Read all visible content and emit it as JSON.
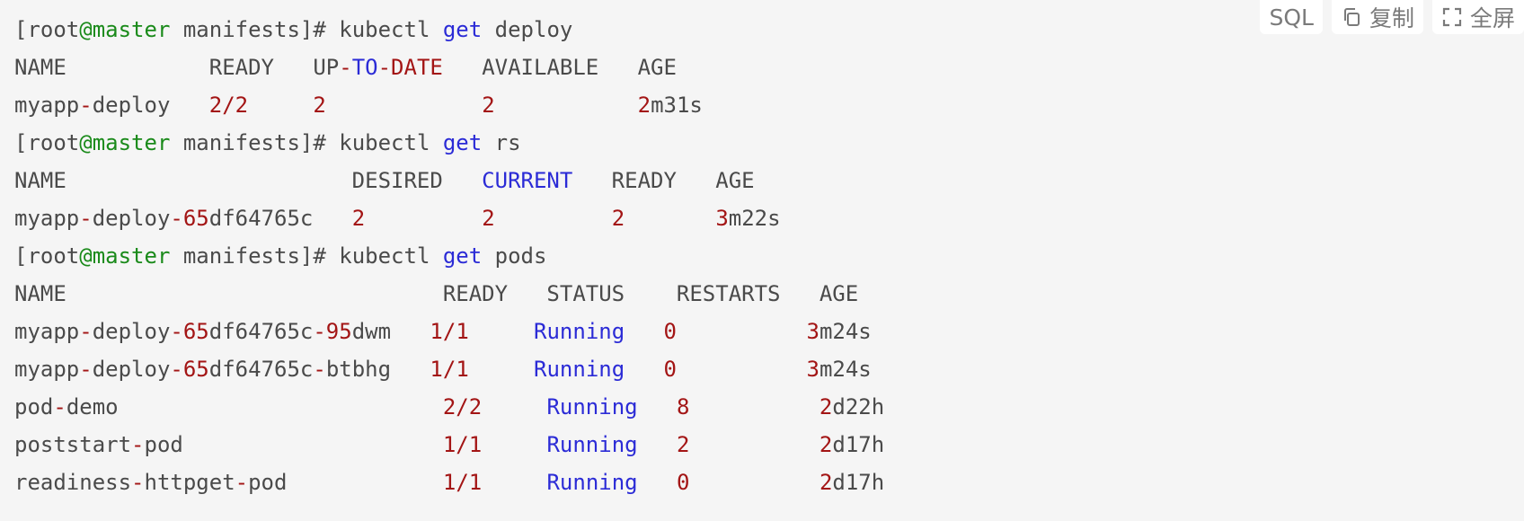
{
  "toolbar": {
    "lang_label": "SQL",
    "copy_label": "复制",
    "fullscreen_label": "全屏",
    "copy_icon": "copy-icon",
    "fullscreen_icon": "fullscreen-icon"
  },
  "colors": {
    "background": "#f5f5f5",
    "text": "#4a4a4a",
    "prompt_host": "#1a8a1a",
    "keyword": "#2b2bd6",
    "number": "#a31515"
  },
  "lines": [
    [
      {
        "t": "[root"
      },
      {
        "t": "@master",
        "c": "green"
      },
      {
        "t": " manifests]# kubectl "
      },
      {
        "t": "get",
        "c": "blue"
      },
      {
        "t": " deploy"
      }
    ],
    [
      {
        "t": "NAME           READY   UP"
      },
      {
        "t": "-",
        "c": "red"
      },
      {
        "t": "TO",
        "c": "blue"
      },
      {
        "t": "-",
        "c": "red"
      },
      {
        "t": "DATE",
        "c": "red"
      },
      {
        "t": "   AVAILABLE   AGE"
      }
    ],
    [
      {
        "t": "myapp"
      },
      {
        "t": "-",
        "c": "red"
      },
      {
        "t": "deploy   "
      },
      {
        "t": "2",
        "c": "red"
      },
      {
        "t": "/",
        "c": "red"
      },
      {
        "t": "2",
        "c": "red"
      },
      {
        "t": "     "
      },
      {
        "t": "2",
        "c": "red"
      },
      {
        "t": "            "
      },
      {
        "t": "2",
        "c": "red"
      },
      {
        "t": "           "
      },
      {
        "t": "2",
        "c": "red"
      },
      {
        "t": "m31s"
      }
    ],
    [
      {
        "t": "[root"
      },
      {
        "t": "@master",
        "c": "green"
      },
      {
        "t": " manifests]# kubectl "
      },
      {
        "t": "get",
        "c": "blue"
      },
      {
        "t": " rs"
      }
    ],
    [
      {
        "t": "NAME                      DESIRED   "
      },
      {
        "t": "CURRENT",
        "c": "blue"
      },
      {
        "t": "   READY   AGE"
      }
    ],
    [
      {
        "t": "myapp"
      },
      {
        "t": "-",
        "c": "red"
      },
      {
        "t": "deploy"
      },
      {
        "t": "-65",
        "c": "red"
      },
      {
        "t": "df64765c   "
      },
      {
        "t": "2",
        "c": "red"
      },
      {
        "t": "         "
      },
      {
        "t": "2",
        "c": "red"
      },
      {
        "t": "         "
      },
      {
        "t": "2",
        "c": "red"
      },
      {
        "t": "       "
      },
      {
        "t": "3",
        "c": "red"
      },
      {
        "t": "m22s"
      }
    ],
    [
      {
        "t": "[root"
      },
      {
        "t": "@master",
        "c": "green"
      },
      {
        "t": " manifests]# kubectl "
      },
      {
        "t": "get",
        "c": "blue"
      },
      {
        "t": " pods"
      }
    ],
    [
      {
        "t": "NAME                             READY   STATUS    RESTARTS   AGE"
      }
    ],
    [
      {
        "t": "myapp"
      },
      {
        "t": "-",
        "c": "red"
      },
      {
        "t": "deploy"
      },
      {
        "t": "-65",
        "c": "red"
      },
      {
        "t": "df64765c"
      },
      {
        "t": "-95",
        "c": "red"
      },
      {
        "t": "dwm   "
      },
      {
        "t": "1",
        "c": "red"
      },
      {
        "t": "/",
        "c": "red"
      },
      {
        "t": "1",
        "c": "red"
      },
      {
        "t": "     "
      },
      {
        "t": "Running",
        "c": "blue"
      },
      {
        "t": "   "
      },
      {
        "t": "0",
        "c": "red"
      },
      {
        "t": "          "
      },
      {
        "t": "3",
        "c": "red"
      },
      {
        "t": "m24s"
      }
    ],
    [
      {
        "t": "myapp"
      },
      {
        "t": "-",
        "c": "red"
      },
      {
        "t": "deploy"
      },
      {
        "t": "-65",
        "c": "red"
      },
      {
        "t": "df64765c"
      },
      {
        "t": "-",
        "c": "red"
      },
      {
        "t": "btbhg   "
      },
      {
        "t": "1",
        "c": "red"
      },
      {
        "t": "/",
        "c": "red"
      },
      {
        "t": "1",
        "c": "red"
      },
      {
        "t": "     "
      },
      {
        "t": "Running",
        "c": "blue"
      },
      {
        "t": "   "
      },
      {
        "t": "0",
        "c": "red"
      },
      {
        "t": "          "
      },
      {
        "t": "3",
        "c": "red"
      },
      {
        "t": "m24s"
      }
    ],
    [
      {
        "t": "pod"
      },
      {
        "t": "-",
        "c": "red"
      },
      {
        "t": "demo                         "
      },
      {
        "t": "2",
        "c": "red"
      },
      {
        "t": "/",
        "c": "red"
      },
      {
        "t": "2",
        "c": "red"
      },
      {
        "t": "     "
      },
      {
        "t": "Running",
        "c": "blue"
      },
      {
        "t": "   "
      },
      {
        "t": "8",
        "c": "red"
      },
      {
        "t": "          "
      },
      {
        "t": "2",
        "c": "red"
      },
      {
        "t": "d22h"
      }
    ],
    [
      {
        "t": "poststart"
      },
      {
        "t": "-",
        "c": "red"
      },
      {
        "t": "pod                    "
      },
      {
        "t": "1",
        "c": "red"
      },
      {
        "t": "/",
        "c": "red"
      },
      {
        "t": "1",
        "c": "red"
      },
      {
        "t": "     "
      },
      {
        "t": "Running",
        "c": "blue"
      },
      {
        "t": "   "
      },
      {
        "t": "2",
        "c": "red"
      },
      {
        "t": "          "
      },
      {
        "t": "2",
        "c": "red"
      },
      {
        "t": "d17h"
      }
    ],
    [
      {
        "t": "readiness"
      },
      {
        "t": "-",
        "c": "red"
      },
      {
        "t": "httpget"
      },
      {
        "t": "-",
        "c": "red"
      },
      {
        "t": "pod            "
      },
      {
        "t": "1",
        "c": "red"
      },
      {
        "t": "/",
        "c": "red"
      },
      {
        "t": "1",
        "c": "red"
      },
      {
        "t": "     "
      },
      {
        "t": "Running",
        "c": "blue"
      },
      {
        "t": "   "
      },
      {
        "t": "0",
        "c": "red"
      },
      {
        "t": "          "
      },
      {
        "t": "2",
        "c": "red"
      },
      {
        "t": "d17h"
      }
    ]
  ]
}
